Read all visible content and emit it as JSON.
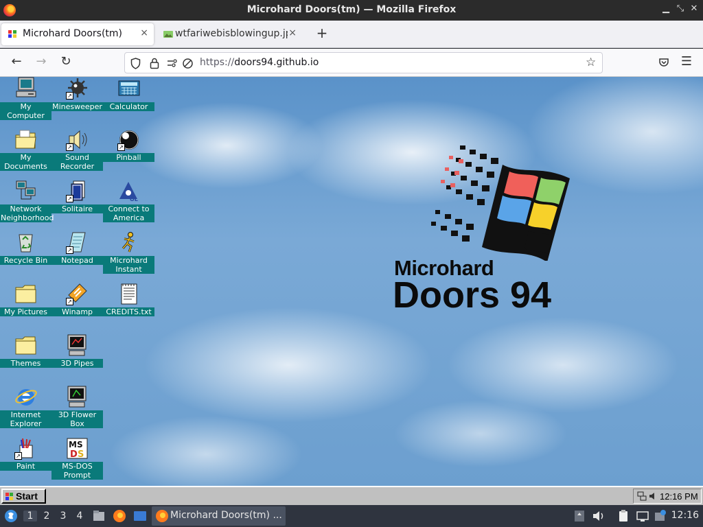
{
  "window": {
    "title": "Microhard Doors(tm) — Mozilla Firefox"
  },
  "tabs": [
    {
      "label": "Microhard Doors(tm)",
      "close": "×"
    },
    {
      "label": "wtfariwebisblowingup.jpe",
      "close": "×"
    }
  ],
  "new_tab_label": "+",
  "address": {
    "protocol": "https://",
    "host": "doors94.github.io"
  },
  "desktop_icons": [
    {
      "label": "My Computer"
    },
    {
      "label": "Minesweeper"
    },
    {
      "label": "Calculator"
    },
    {
      "label": "My Documents"
    },
    {
      "label": "Sound Recorder"
    },
    {
      "label": "Pinball"
    },
    {
      "label": "Network Neighborhood"
    },
    {
      "label": "Solitaire"
    },
    {
      "label": "Connect to America"
    },
    {
      "label": "Recycle Bin"
    },
    {
      "label": "Notepad"
    },
    {
      "label": "Microhard Instant"
    },
    {
      "label": "My Pictures"
    },
    {
      "label": "Winamp"
    },
    {
      "label": "CREDITS.txt"
    },
    {
      "label": "Themes"
    },
    {
      "label": "3D Pipes"
    },
    {
      "label": "Internet Explorer"
    },
    {
      "label": "3D Flower Box"
    },
    {
      "label": "Paint"
    },
    {
      "label": "MS-DOS Prompt"
    }
  ],
  "logo": {
    "line1": "Microhard",
    "line2": "Doors 94"
  },
  "taskbar95": {
    "start_label": "Start",
    "clock": "12:16 PM"
  },
  "panel": {
    "workspaces": [
      "1",
      "2",
      "3",
      "4"
    ],
    "task_label": "Microhard Doors(tm) ...",
    "clock": "12:16"
  }
}
